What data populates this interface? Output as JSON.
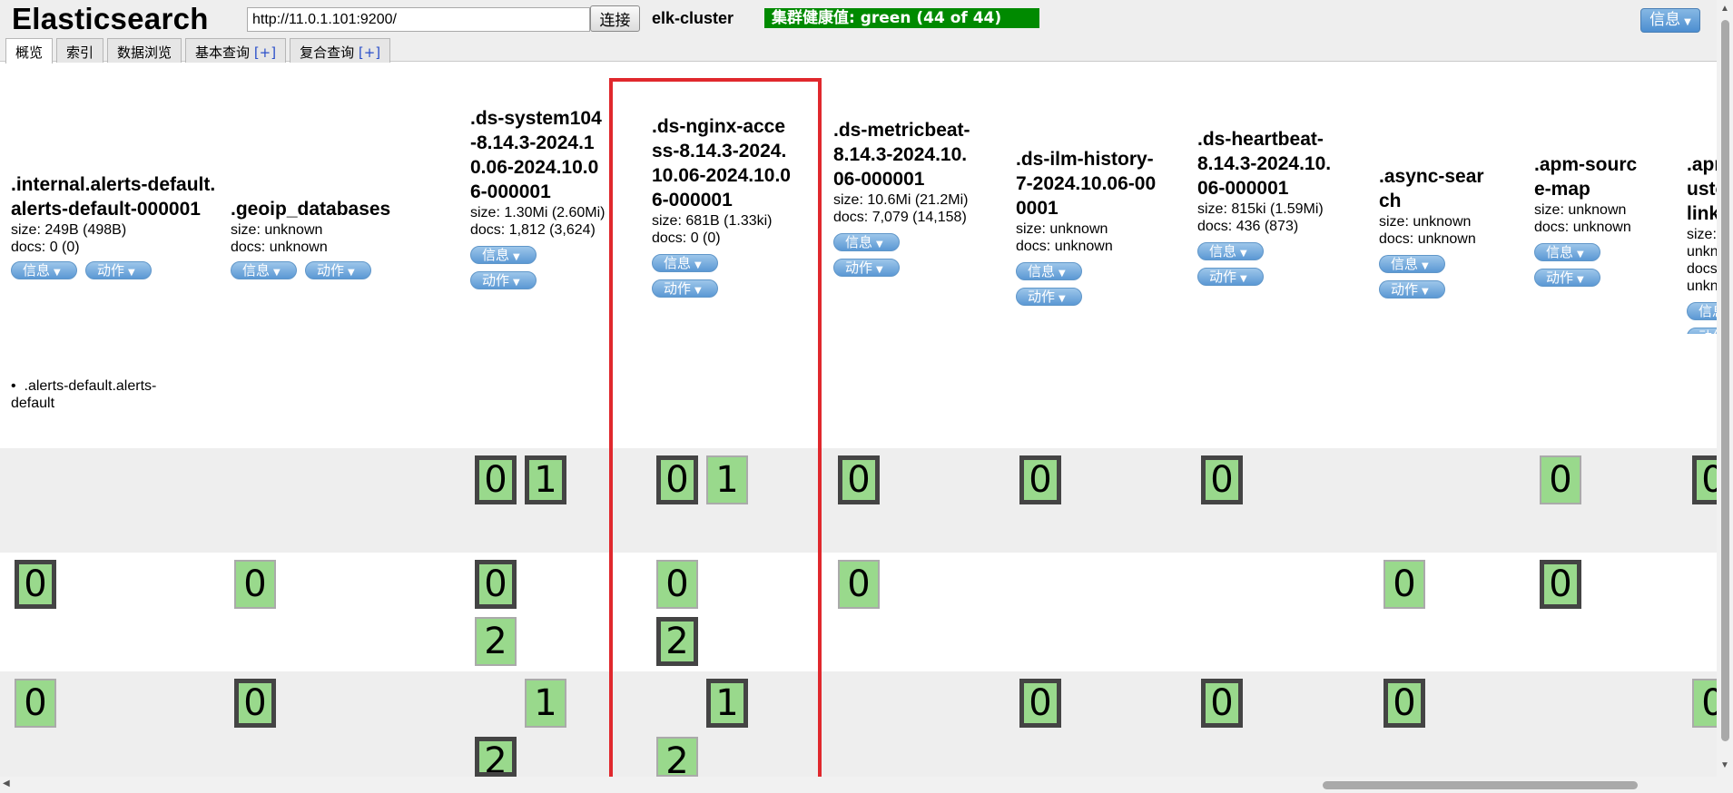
{
  "app": {
    "title": "Elasticsearch"
  },
  "connection": {
    "url": "http://11.0.1.101:9200/",
    "connect_label": "连接",
    "cluster_name": "elk-cluster",
    "health": "集群健康值: green (44 of 44)"
  },
  "menu": {
    "info_label": "信息"
  },
  "tabs": [
    {
      "label": "概览",
      "plus": ""
    },
    {
      "label": "索引",
      "plus": ""
    },
    {
      "label": "数据浏览",
      "plus": ""
    },
    {
      "label": "基本查询 ",
      "plus": "[+]"
    },
    {
      "label": "复合查询 ",
      "plus": "[+]"
    }
  ],
  "pill_labels": {
    "info": "信息",
    "action": "动作"
  },
  "indices": [
    {
      "name": ".internal.alerts-default.alerts-default-000001",
      "size": "size: 249B (498B)",
      "docs": "docs: 0 (0)"
    },
    {
      "name": ".geoip_databases",
      "size": "size: unknown",
      "docs": "docs: unknown"
    },
    {
      "name": ".ds-system104-8.14.3-2024.10.06-2024.10.06-000001",
      "size": "size: 1.30Mi (2.60Mi)",
      "docs": "docs: 1,812 (3,624)"
    },
    {
      "name": ".ds-nginx-access-8.14.3-2024.10.06-2024.10.06-000001",
      "size": "size: 681B (1.33ki)",
      "docs": "docs: 0 (0)"
    },
    {
      "name": ".ds-metricbeat-8.14.3-2024.10.06-000001",
      "size": "size: 10.6Mi (21.2Mi)",
      "docs": "docs: 7,079 (14,158)"
    },
    {
      "name": ".ds-ilm-history-7-2024.10.06-000001",
      "size": "size: unknown",
      "docs": "docs: unknown"
    },
    {
      "name": ".ds-heartbeat-8.14.3-2024.10.06-000001",
      "size": "size: 815ki (1.59Mi)",
      "docs": "docs: 436 (873)"
    },
    {
      "name": ".async-search",
      "size": "size: unknown",
      "docs": "docs: unknown"
    },
    {
      "name": ".apm-source-map",
      "size": "size: unknown",
      "docs": "docs: unknown"
    },
    {
      "name": ".apm-custom-link",
      "size": "size: unknown",
      "docs": "docs: unknown"
    }
  ],
  "alias": ".alerts-default.alerts-default",
  "shards": {
    "zero": "0",
    "one": "1",
    "two": "2"
  }
}
